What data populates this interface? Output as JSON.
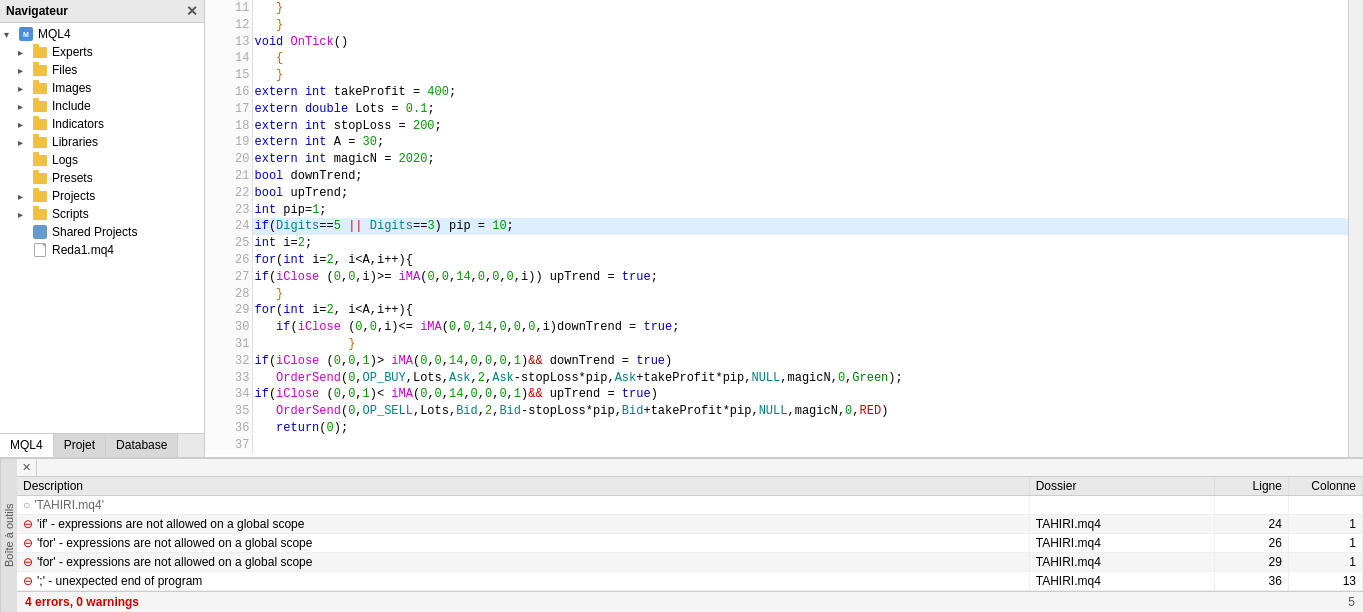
{
  "navigator": {
    "title": "Navigateur",
    "tree": [
      {
        "id": "mql4",
        "label": "MQL4",
        "indent": 0,
        "type": "mql4",
        "expander": "▾"
      },
      {
        "id": "experts",
        "label": "Experts",
        "indent": 1,
        "type": "folder",
        "expander": "▸"
      },
      {
        "id": "files",
        "label": "Files",
        "indent": 1,
        "type": "folder",
        "expander": "▸"
      },
      {
        "id": "images",
        "label": "Images",
        "indent": 1,
        "type": "folder",
        "expander": "▸"
      },
      {
        "id": "include",
        "label": "Include",
        "indent": 1,
        "type": "folder",
        "expander": "▸"
      },
      {
        "id": "indicators",
        "label": "Indicators",
        "indent": 1,
        "type": "folder",
        "expander": "▸"
      },
      {
        "id": "libraries",
        "label": "Libraries",
        "indent": 1,
        "type": "folder",
        "expander": "▸"
      },
      {
        "id": "logs",
        "label": "Logs",
        "indent": 1,
        "type": "folder",
        "expander": ""
      },
      {
        "id": "presets",
        "label": "Presets",
        "indent": 1,
        "type": "folder",
        "expander": ""
      },
      {
        "id": "projects",
        "label": "Projects",
        "indent": 1,
        "type": "folder",
        "expander": "▸"
      },
      {
        "id": "scripts",
        "label": "Scripts",
        "indent": 1,
        "type": "folder",
        "expander": "▸"
      },
      {
        "id": "shared_projects",
        "label": "Shared Projects",
        "indent": 1,
        "type": "shared",
        "expander": ""
      },
      {
        "id": "reda_mq4",
        "label": "Reda1.mq4",
        "indent": 1,
        "type": "file",
        "expander": ""
      }
    ],
    "tabs": [
      {
        "id": "mql4",
        "label": "MQL4",
        "active": true
      },
      {
        "id": "projet",
        "label": "Projet",
        "active": false
      },
      {
        "id": "database",
        "label": "Database",
        "active": false
      }
    ]
  },
  "code": {
    "lines": [
      {
        "num": 11,
        "code": "   }",
        "style": "normal"
      },
      {
        "num": 12,
        "code": "   }",
        "style": "normal"
      },
      {
        "num": 13,
        "code": "void OnTick()",
        "style": "keyword_fn"
      },
      {
        "num": 14,
        "code": "   {",
        "style": "normal"
      },
      {
        "num": 15,
        "code": "   }",
        "style": "normal"
      },
      {
        "num": 16,
        "code": "extern int takeProfit = 400;",
        "style": "extern"
      },
      {
        "num": 17,
        "code": "extern double Lots = 0.1;",
        "style": "extern"
      },
      {
        "num": 18,
        "code": "extern int stopLoss = 200;",
        "style": "extern"
      },
      {
        "num": 19,
        "code": "extern int A = 30;",
        "style": "extern"
      },
      {
        "num": 20,
        "code": "extern int magicN = 2020;",
        "style": "extern"
      },
      {
        "num": 21,
        "code": "bool downTrend;",
        "style": "normal"
      },
      {
        "num": 22,
        "code": "bool upTrend;",
        "style": "normal"
      },
      {
        "num": 23,
        "code": "int pip=1;",
        "style": "normal"
      },
      {
        "num": 24,
        "code": "if(Digits==5 || Digits==3) pip = 10;",
        "style": "highlight"
      },
      {
        "num": 25,
        "code": "int i=2;",
        "style": "normal"
      },
      {
        "num": 26,
        "code": "for(int i=2, i<A,i++){",
        "style": "normal"
      },
      {
        "num": 27,
        "code": "if(iClose (0,0,i)>= iMA(0,0,14,0,0,0,i)) upTrend = true;",
        "style": "normal"
      },
      {
        "num": 28,
        "code": "   }",
        "style": "normal"
      },
      {
        "num": 29,
        "code": "for(int i=2, i<A,i++){",
        "style": "normal"
      },
      {
        "num": 30,
        "code": "   if(iClose (0,0,i)<= iMA(0,0,14,0,0,0,i)downTrend = true;",
        "style": "normal"
      },
      {
        "num": 31,
        "code": "             }",
        "style": "normal"
      },
      {
        "num": 32,
        "code": "if(iClose (0,0,1)> iMA(0,0,14,0,0,0,1)&& downTrend = true)",
        "style": "normal"
      },
      {
        "num": 33,
        "code": "   OrderSend(0,OP_BUY,Lots,Ask,2,Ask-stopLoss*pip,Ask+takeProfit*pip,NULL,magicN,0,Green);",
        "style": "normal"
      },
      {
        "num": 34,
        "code": "if(iClose (0,0,1)< iMA(0,0,14,0,0,0,1)&& upTrend = true)",
        "style": "normal"
      },
      {
        "num": 35,
        "code": "   OrderSend(0,OP_SELL,Lots,Bid,2,Bid-stopLoss*pip,Bid+takeProfit*pip,NULL,magicN,0,RED)",
        "style": "normal"
      },
      {
        "num": 36,
        "code": "   return(0);",
        "style": "normal"
      },
      {
        "num": 37,
        "code": "",
        "style": "normal"
      }
    ]
  },
  "bottom": {
    "columns": {
      "description": "Description",
      "dossier": "Dossier",
      "ligne": "Ligne",
      "colonne": "Colonne"
    },
    "rows": [
      {
        "type": "info",
        "description": "'TAHIRI.mq4'",
        "dossier": "",
        "ligne": "",
        "colonne": ""
      },
      {
        "type": "error",
        "description": "'if' - expressions are not allowed on a global scope",
        "dossier": "TAHIRI.mq4",
        "ligne": "24",
        "colonne": "1"
      },
      {
        "type": "error",
        "description": "'for' - expressions are not allowed on a global scope",
        "dossier": "TAHIRI.mq4",
        "ligne": "26",
        "colonne": "1"
      },
      {
        "type": "error",
        "description": "'for' - expressions are not allowed on a global scope",
        "dossier": "TAHIRI.mq4",
        "ligne": "29",
        "colonne": "1"
      },
      {
        "type": "error",
        "description": "';' - unexpected end of program",
        "dossier": "TAHIRI.mq4",
        "ligne": "36",
        "colonne": "13"
      }
    ],
    "status": "4 errors, 0 warnings",
    "status_count": "5",
    "tools_label": "Boîte à outils"
  }
}
